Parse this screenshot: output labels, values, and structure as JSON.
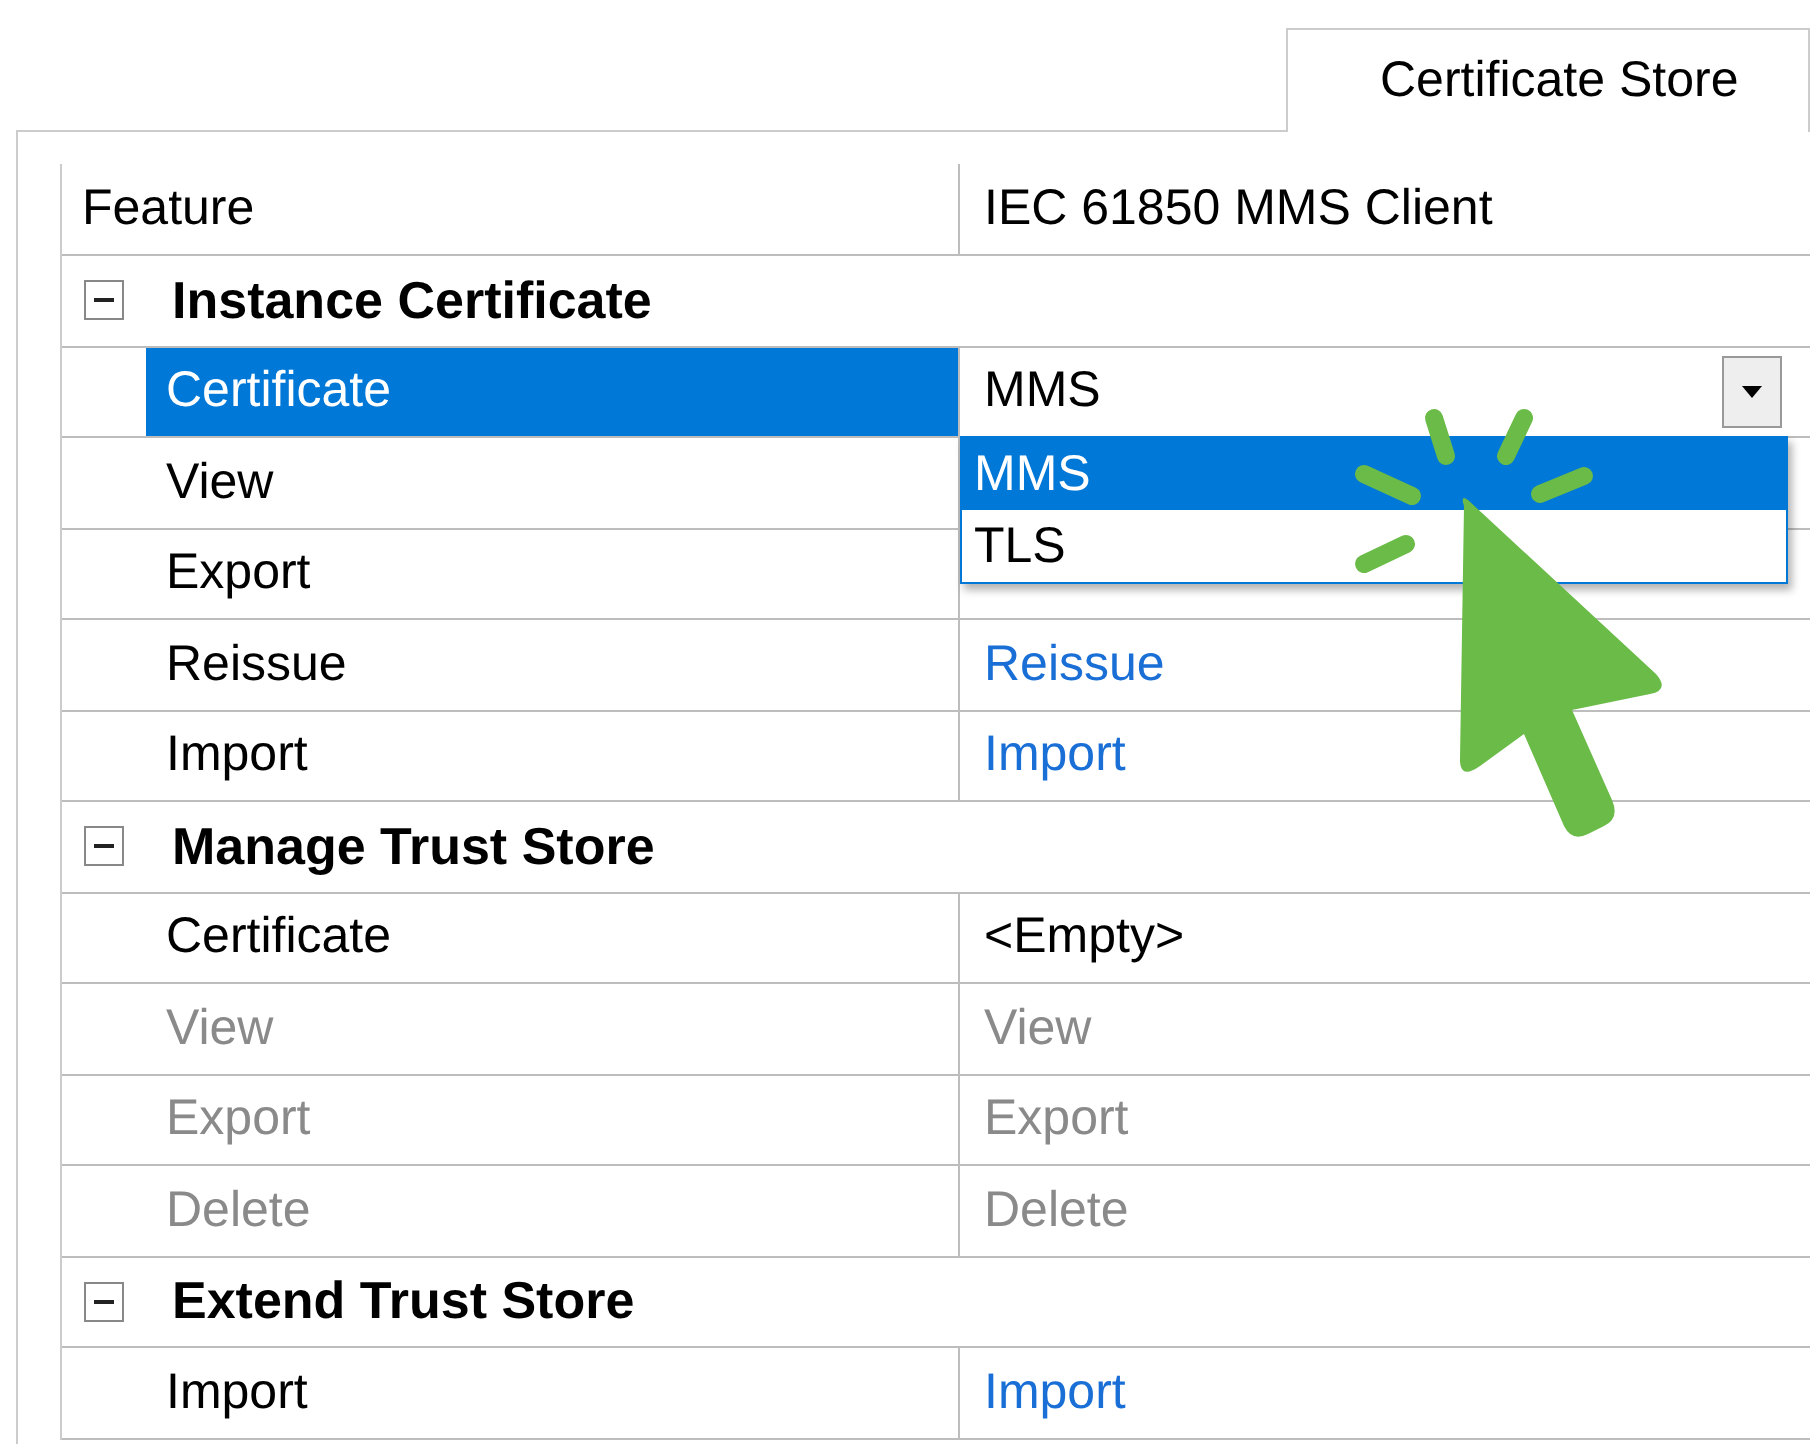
{
  "tab": {
    "label": "Certificate Store",
    "selected": true
  },
  "header": {
    "feature": "Feature",
    "value": "IEC 61850 MMS Client"
  },
  "categories": [
    {
      "title": "Instance Certificate",
      "expanded": true,
      "rows": [
        {
          "name": "Certificate",
          "value": "MMS",
          "kind": "dropdown",
          "disabled": false,
          "selected": true,
          "open": true,
          "options": [
            {
              "label": "MMS",
              "selected": true
            },
            {
              "label": "TLS",
              "selected": false
            }
          ]
        },
        {
          "name": "View",
          "kind": "empty",
          "disabled": false,
          "selected": false
        },
        {
          "name": "Export",
          "kind": "empty",
          "disabled": false,
          "selected": false
        },
        {
          "name": "Reissue",
          "value": "Reissue",
          "kind": "link",
          "disabled": false,
          "selected": false
        },
        {
          "name": "Import",
          "value": "Import",
          "kind": "link",
          "disabled": false,
          "selected": false
        }
      ]
    },
    {
      "title": "Manage Trust Store",
      "expanded": true,
      "rows": [
        {
          "name": "Certificate",
          "value": "<Empty>",
          "kind": "text",
          "disabled": false,
          "selected": false
        },
        {
          "name": "View",
          "value": "View",
          "kind": "link",
          "disabled": true,
          "selected": false
        },
        {
          "name": "Export",
          "value": "Export",
          "kind": "link",
          "disabled": true,
          "selected": false
        },
        {
          "name": "Delete",
          "value": "Delete",
          "kind": "link",
          "disabled": true,
          "selected": false
        }
      ]
    },
    {
      "title": "Extend Trust Store",
      "expanded": true,
      "rows": [
        {
          "name": "Import",
          "value": "Import",
          "kind": "link",
          "disabled": false,
          "selected": false
        }
      ]
    }
  ]
}
